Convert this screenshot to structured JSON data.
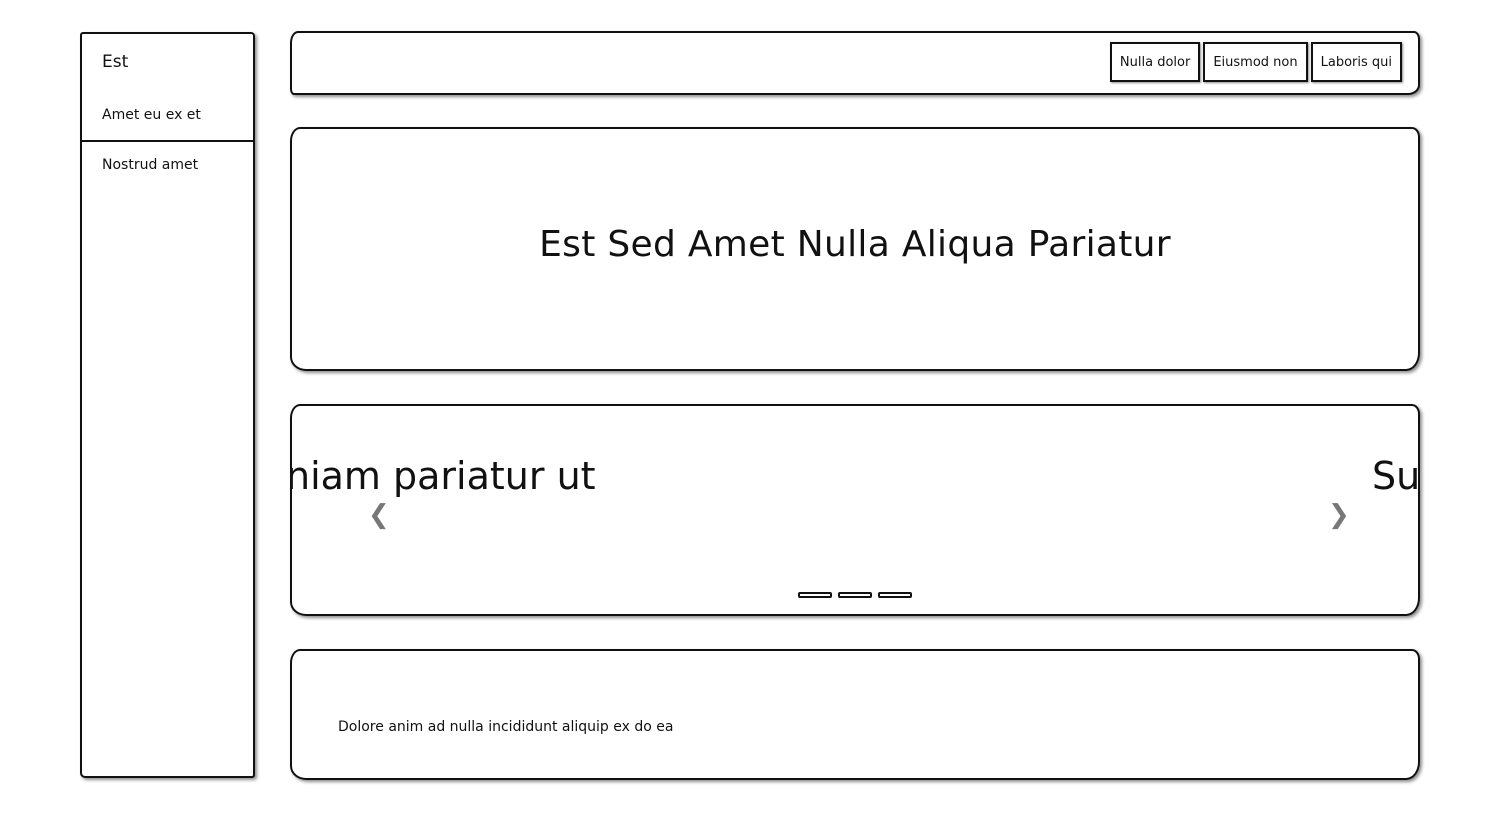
{
  "sidebar": {
    "title": "Est",
    "links": [
      {
        "label": "Amet eu ex et"
      },
      {
        "label": "Nostrud amet"
      }
    ]
  },
  "header": {
    "nav": [
      {
        "label": "Nulla dolor"
      },
      {
        "label": "Eiusmod non"
      },
      {
        "label": "Laboris qui"
      }
    ]
  },
  "hero": {
    "title": "Est Sed Amet Nulla Aliqua Pariatur"
  },
  "carousel": {
    "slide_left_text": "niam pariatur ut",
    "slide_right_text": "Sur",
    "prev_icon": "chevron-left-icon",
    "next_icon": "chevron-right-icon",
    "indicator_count": 3
  },
  "card": {
    "text": "Dolore anim ad nulla incididunt aliquip ex do ea"
  }
}
